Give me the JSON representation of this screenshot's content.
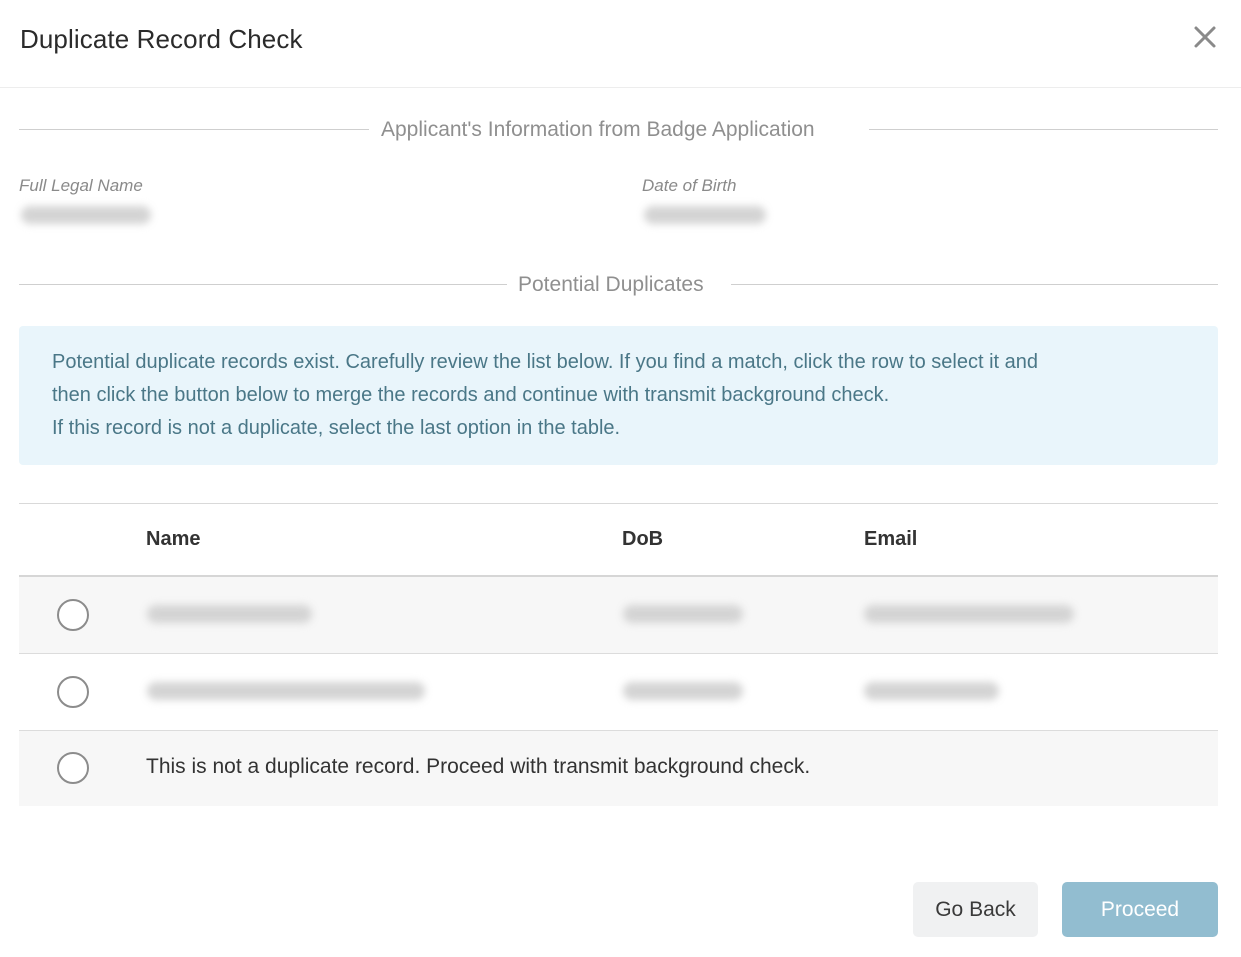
{
  "dialog": {
    "title": "Duplicate Record Check",
    "close_icon": "close-icon"
  },
  "applicant_section": {
    "heading": "Applicant's Information from Badge Application",
    "full_name_label": "Full Legal Name",
    "dob_label": "Date of Birth"
  },
  "duplicates_section": {
    "heading": "Potential Duplicates",
    "info_lines": [
      "Potential duplicate records exist. Carefully review the list below. If you find a match, click the row to select it and",
      "then click the button below to merge the records and continue with transmit background check.",
      "If this record is not a duplicate, select the last option in the table."
    ]
  },
  "table": {
    "columns": [
      "Name",
      "DoB",
      "Email"
    ],
    "none_option_label": "This is not a duplicate record. Proceed with transmit background check."
  },
  "footer": {
    "back_label": "Go Back",
    "proceed_label": "Proceed"
  },
  "colors": {
    "info_bg": "#e9f5fb",
    "info_text": "#4a7787",
    "proceed_bg": "#92bdd0"
  }
}
